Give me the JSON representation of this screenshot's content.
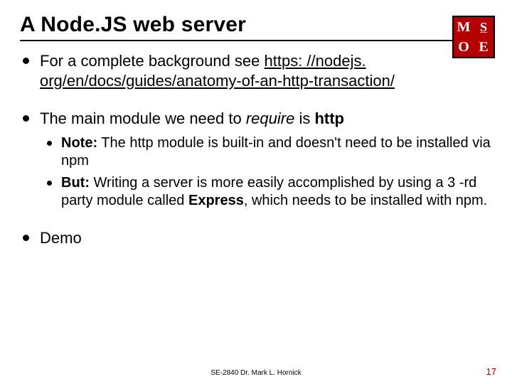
{
  "title": "A Node.JS web server",
  "logo": {
    "tl": "M",
    "tr": "S",
    "bl": "O",
    "br": "E"
  },
  "bullets": {
    "b1_intro": "For a complete background see ",
    "b1_link": "https: //nodejs. org/en/docs/guides/anatomy-of-an-http-transaction/",
    "b2_pre": "The main module we need to ",
    "b2_require": "require",
    "b2_mid": " is ",
    "b2_http": "http",
    "b2_sub1_note": "Note:",
    "b2_sub1_rest": " The http module is built-in and doesn't need to be installed via npm",
    "b2_sub2_but": "But:",
    "b2_sub2_mid1": " Writing a server is more easily accomplished by using a 3 -rd party module called ",
    "b2_sub2_express": "Express",
    "b2_sub2_end": ", which needs to be installed with npm.",
    "b3": "Demo"
  },
  "footer": "SE-2840 Dr. Mark L. Hornick",
  "page": "17"
}
